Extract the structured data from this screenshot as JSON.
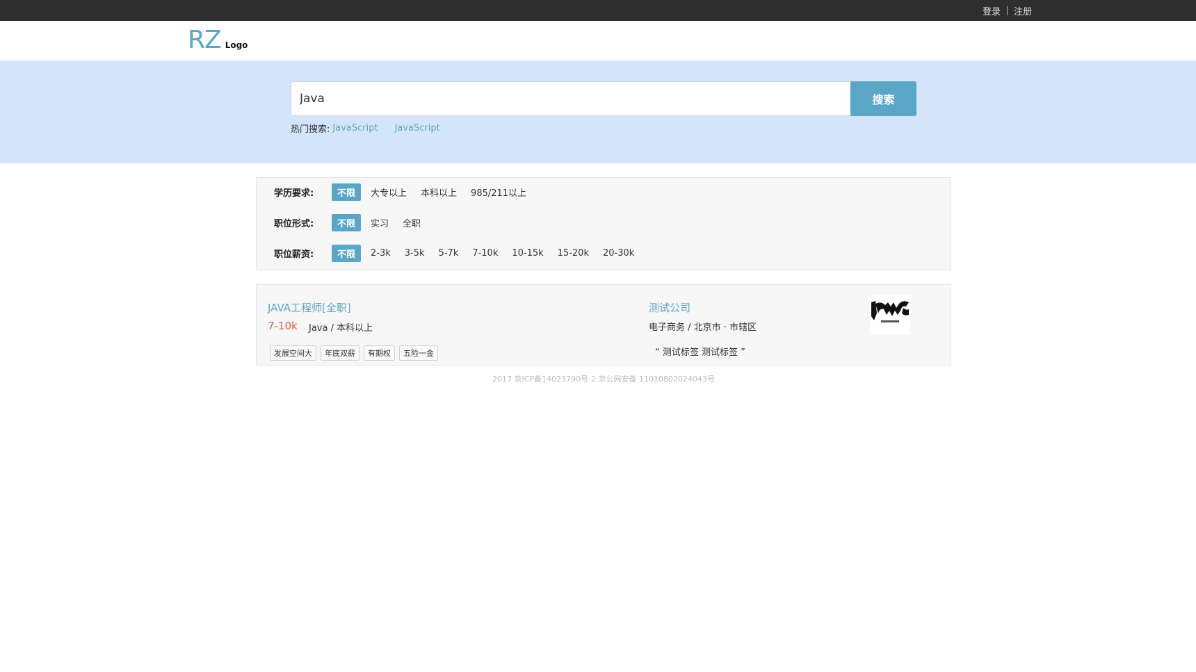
{
  "topbar": {
    "login": "登录",
    "register": "注册"
  },
  "header": {
    "logo_mark": "RZ",
    "logo_text": "Logo"
  },
  "search": {
    "value": "Java",
    "button": "搜索",
    "hot_label": "热门搜索:",
    "hot_items": [
      "JavaScript",
      "JavaScript"
    ]
  },
  "filters": {
    "education": {
      "label": "学历要求:",
      "options": [
        "不限",
        "大专以上",
        "本科以上",
        "985/211以上"
      ]
    },
    "job_type": {
      "label": "职位形式:",
      "options": [
        "不限",
        "实习",
        "全职"
      ]
    },
    "salary": {
      "label": "职位薪资:",
      "options": [
        "不限",
        "2-3k",
        "3-5k",
        "5-7k",
        "7-10k",
        "10-15k",
        "15-20k",
        "20-30k"
      ]
    }
  },
  "job": {
    "title": "JAVA工程师[全职]",
    "salary": "7-10k",
    "requirements": "Java / 本科以上",
    "tags": [
      "发展空间大",
      "年底双薪",
      "有期权",
      "五险一金"
    ],
    "company": "测试公司",
    "company_info": "电子商务 / 北京市 · 市辖区",
    "company_quote": "“ 测试标签 测试标签 ”"
  },
  "footer": {
    "text": "2017 京ICP备14023790号-2 京公网安备 11010802024043号"
  },
  "colors": {
    "accent": "#5aa6c6",
    "salary": "#f0544d",
    "topbar": "#2e2e2e",
    "band": "#d4e5fb"
  }
}
